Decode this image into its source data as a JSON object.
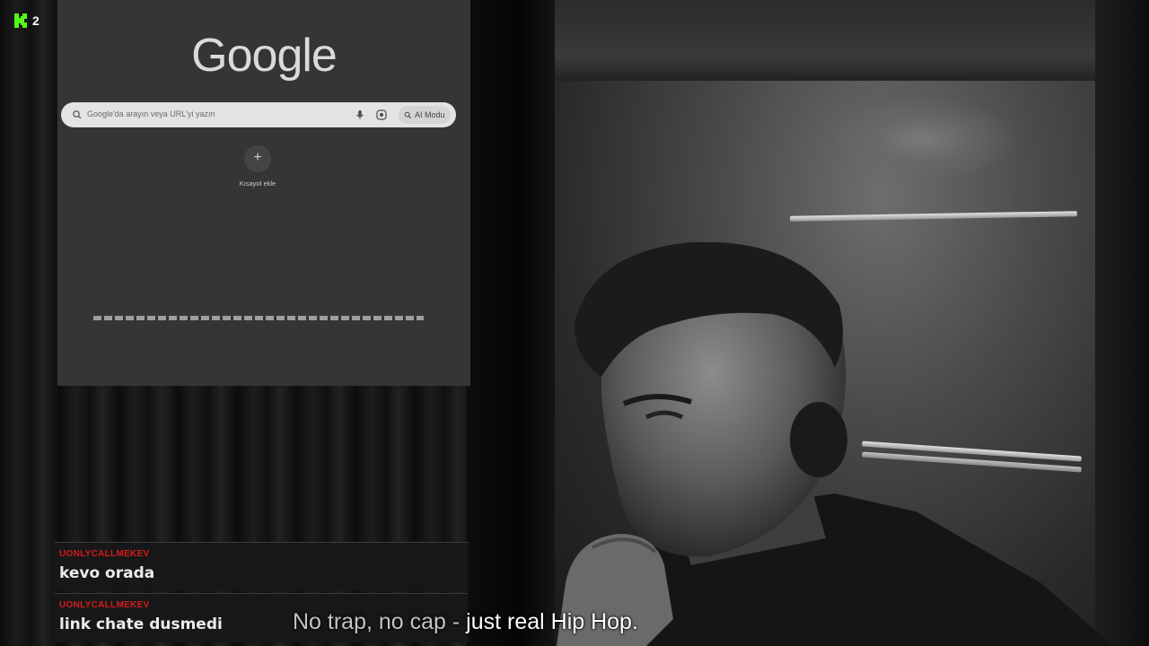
{
  "overlay": {
    "kick_viewer_count": "2",
    "colors": {
      "kick_green": "#53fc18",
      "chat_username": "#d41c1c"
    }
  },
  "browser": {
    "logo_text": "Google",
    "search": {
      "placeholder": "Google'da arayın veya URL'yi yazın",
      "ai_mode_label": "AI Modu",
      "icons": [
        "search-icon",
        "microphone-icon",
        "lens-icon",
        "ai-mode-icon"
      ]
    },
    "shortcut": {
      "add_symbol": "+",
      "label": "Kısayol ekle"
    }
  },
  "chat": {
    "messages": [
      {
        "username": "UONLYCALLMEKEV",
        "text": "kevo orada"
      },
      {
        "username": "UONLYCALLMEKEV",
        "text": "link chate dusmedi"
      }
    ]
  },
  "caption": {
    "spoken": "No trap, no cap - ",
    "current": "just real Hip Hop."
  }
}
